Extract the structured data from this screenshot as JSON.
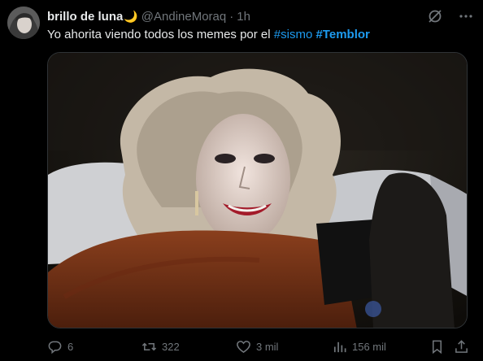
{
  "post": {
    "display_name": "brillo de luna",
    "handle": "@AndineMoraq",
    "separator": "·",
    "time": "1h",
    "text_before": "Yo ahorita viendo todos los memes por el ",
    "hashtag_1": "#sismo",
    "hashtag_2": "#Temblor"
  },
  "actions": {
    "replies": "6",
    "reposts": "322",
    "likes": "3 mil",
    "views": "156 mil"
  },
  "icons": {
    "moon": "crescent-moon-icon",
    "grok": "grok-icon",
    "more": "more-options-icon",
    "reply": "reply-icon",
    "repost": "repost-icon",
    "like": "like-icon",
    "views": "views-icon",
    "bookmark": "bookmark-icon",
    "share": "share-icon"
  },
  "colors": {
    "background": "#000000",
    "text": "#e7e9ea",
    "muted": "#71767b",
    "link": "#1d9bf0"
  }
}
